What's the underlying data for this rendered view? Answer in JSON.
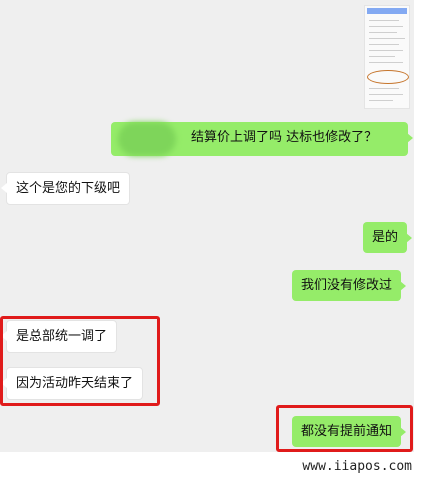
{
  "messages": [
    {
      "side": "out",
      "text": "结算价上调了吗  达标也修改了？"
    },
    {
      "side": "in",
      "text": "这个是您的下级吧"
    },
    {
      "side": "out",
      "text": "是的"
    },
    {
      "side": "out",
      "text": "我们没有修改过"
    },
    {
      "side": "in",
      "text": "是总部统一调了"
    },
    {
      "side": "in",
      "text": "因为活动昨天结束了"
    },
    {
      "side": "out",
      "text": "都没有提前通知"
    }
  ],
  "watermark": "www.iiapos.com",
  "colors": {
    "chat_background": "#efefef",
    "outgoing_bubble": "#95ec69",
    "incoming_bubble": "#ffffff",
    "highlight_box": "#e01b1b"
  }
}
